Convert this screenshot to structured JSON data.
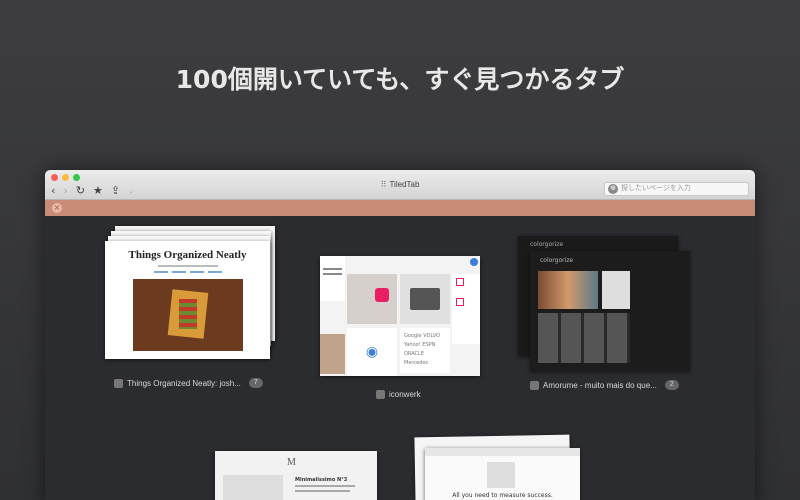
{
  "headline": "100個開いていても、すぐ見つかるタブ",
  "window": {
    "title": "TiledTab",
    "url_placeholder": "探したいページを入力",
    "colors": {
      "close": "#fc605c",
      "minimize": "#fdbc40",
      "zoom": "#34c84a",
      "accent_bar": "#c98c78"
    }
  },
  "tabs": [
    {
      "label": "Things Organized Neatly: josh...",
      "count": "7",
      "page_title": "Things Organized Neatly"
    },
    {
      "label": "iconwerk",
      "count": ""
    },
    {
      "label": "Amorume - muito mais do que...",
      "count": "2",
      "page_title": "colorgorize"
    }
  ],
  "lower_tiles": [
    {
      "page_title": "Minimalissimo N°3",
      "logo": "M"
    },
    {
      "page_title": "All you need to measure success."
    }
  ]
}
